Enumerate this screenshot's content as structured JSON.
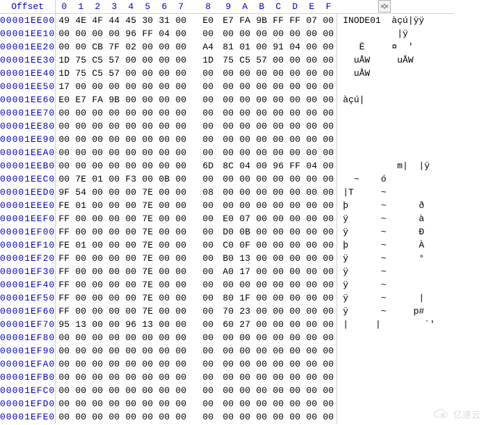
{
  "header": {
    "offset_label": "Offset",
    "columns": [
      "0",
      "1",
      "2",
      "3",
      "4",
      "5",
      "6",
      "7",
      "8",
      "9",
      "A",
      "B",
      "C",
      "D",
      "E",
      "F"
    ],
    "ascii_label": ""
  },
  "rows": [
    {
      "offset": "00001EE00",
      "hex": [
        "49",
        "4E",
        "4F",
        "44",
        "45",
        "30",
        "31",
        "00",
        "E0",
        "E7",
        "FA",
        "9B",
        "FF",
        "FF",
        "07",
        "00"
      ],
      "ascii": "INODE01  àçú|ÿÿ"
    },
    {
      "offset": "00001EE10",
      "hex": [
        "00",
        "00",
        "00",
        "00",
        "96",
        "FF",
        "04",
        "00",
        "00",
        "00",
        "00",
        "00",
        "00",
        "00",
        "00",
        "00"
      ],
      "ascii": "          |ÿ"
    },
    {
      "offset": "00001EE20",
      "hex": [
        "00",
        "00",
        "CB",
        "7F",
        "02",
        "00",
        "00",
        "00",
        "A4",
        "81",
        "01",
        "00",
        "91",
        "04",
        "00",
        "00"
      ],
      "ascii": "   Ë     ¤  '"
    },
    {
      "offset": "00001EE30",
      "hex": [
        "1D",
        "75",
        "C5",
        "57",
        "00",
        "00",
        "00",
        "00",
        "1D",
        "75",
        "C5",
        "57",
        "00",
        "00",
        "00",
        "00"
      ],
      "ascii": "  uÅW     uÅW"
    },
    {
      "offset": "00001EE40",
      "hex": [
        "1D",
        "75",
        "C5",
        "57",
        "00",
        "00",
        "00",
        "00",
        "00",
        "00",
        "00",
        "00",
        "00",
        "00",
        "00",
        "00"
      ],
      "ascii": "  uÅW"
    },
    {
      "offset": "00001EE50",
      "hex": [
        "17",
        "00",
        "00",
        "00",
        "00",
        "00",
        "00",
        "00",
        "00",
        "00",
        "00",
        "00",
        "00",
        "00",
        "00",
        "00"
      ],
      "ascii": ""
    },
    {
      "offset": "00001EE60",
      "hex": [
        "E0",
        "E7",
        "FA",
        "9B",
        "00",
        "00",
        "00",
        "00",
        "00",
        "00",
        "00",
        "00",
        "00",
        "00",
        "00",
        "00"
      ],
      "ascii": "àçú|"
    },
    {
      "offset": "00001EE70",
      "hex": [
        "00",
        "00",
        "00",
        "00",
        "00",
        "00",
        "00",
        "00",
        "00",
        "00",
        "00",
        "00",
        "00",
        "00",
        "00",
        "00"
      ],
      "ascii": ""
    },
    {
      "offset": "00001EE80",
      "hex": [
        "00",
        "00",
        "00",
        "00",
        "00",
        "00",
        "00",
        "00",
        "00",
        "00",
        "00",
        "00",
        "00",
        "00",
        "00",
        "00"
      ],
      "ascii": ""
    },
    {
      "offset": "00001EE90",
      "hex": [
        "00",
        "00",
        "00",
        "00",
        "00",
        "00",
        "00",
        "00",
        "00",
        "00",
        "00",
        "00",
        "00",
        "00",
        "00",
        "00"
      ],
      "ascii": ""
    },
    {
      "offset": "00001EEA0",
      "hex": [
        "00",
        "00",
        "00",
        "00",
        "00",
        "00",
        "00",
        "00",
        "00",
        "00",
        "00",
        "00",
        "00",
        "00",
        "00",
        "00"
      ],
      "ascii": ""
    },
    {
      "offset": "00001EEB0",
      "hex": [
        "00",
        "00",
        "00",
        "00",
        "00",
        "00",
        "00",
        "00",
        "6D",
        "8C",
        "04",
        "00",
        "96",
        "FF",
        "04",
        "00"
      ],
      "ascii": "          m|  |ÿ"
    },
    {
      "offset": "00001EEC0",
      "hex": [
        "00",
        "7E",
        "01",
        "00",
        "F3",
        "00",
        "0B",
        "00",
        "00",
        "00",
        "00",
        "00",
        "00",
        "00",
        "00",
        "00"
      ],
      "ascii": "  ~    ó"
    },
    {
      "offset": "00001EED0",
      "hex": [
        "9F",
        "54",
        "00",
        "00",
        "00",
        "7E",
        "00",
        "00",
        "08",
        "00",
        "00",
        "00",
        "00",
        "00",
        "00",
        "00"
      ],
      "ascii": "|T     ~"
    },
    {
      "offset": "00001EEE0",
      "hex": [
        "FE",
        "01",
        "00",
        "00",
        "00",
        "7E",
        "00",
        "00",
        "00",
        "00",
        "00",
        "00",
        "00",
        "00",
        "00",
        "00"
      ],
      "ascii": "þ      ~      ð"
    },
    {
      "offset": "00001EEF0",
      "hex": [
        "FF",
        "00",
        "00",
        "00",
        "00",
        "7E",
        "00",
        "00",
        "00",
        "E0",
        "07",
        "00",
        "00",
        "00",
        "00",
        "00"
      ],
      "ascii": "ÿ      ~      à"
    },
    {
      "offset": "00001EF00",
      "hex": [
        "FF",
        "00",
        "00",
        "00",
        "00",
        "7E",
        "00",
        "00",
        "00",
        "D0",
        "0B",
        "00",
        "00",
        "00",
        "00",
        "00"
      ],
      "ascii": "ÿ      ~      Ð"
    },
    {
      "offset": "00001EF10",
      "hex": [
        "FE",
        "01",
        "00",
        "00",
        "00",
        "7E",
        "00",
        "00",
        "00",
        "C0",
        "0F",
        "00",
        "00",
        "00",
        "00",
        "00"
      ],
      "ascii": "þ      ~      À"
    },
    {
      "offset": "00001EF20",
      "hex": [
        "FF",
        "00",
        "00",
        "00",
        "00",
        "7E",
        "00",
        "00",
        "00",
        "B0",
        "13",
        "00",
        "00",
        "00",
        "00",
        "00"
      ],
      "ascii": "ÿ      ~      °"
    },
    {
      "offset": "00001EF30",
      "hex": [
        "FF",
        "00",
        "00",
        "00",
        "00",
        "7E",
        "00",
        "00",
        "00",
        "A0",
        "17",
        "00",
        "00",
        "00",
        "00",
        "00"
      ],
      "ascii": "ÿ      ~"
    },
    {
      "offset": "00001EF40",
      "hex": [
        "FF",
        "00",
        "00",
        "00",
        "00",
        "7E",
        "00",
        "00",
        "00",
        "00",
        "00",
        "00",
        "00",
        "00",
        "00",
        "00"
      ],
      "ascii": "ÿ      ~"
    },
    {
      "offset": "00001EF50",
      "hex": [
        "FF",
        "00",
        "00",
        "00",
        "00",
        "7E",
        "00",
        "00",
        "00",
        "80",
        "1F",
        "00",
        "00",
        "00",
        "00",
        "00"
      ],
      "ascii": "ÿ      ~      |"
    },
    {
      "offset": "00001EF60",
      "hex": [
        "FF",
        "00",
        "00",
        "00",
        "00",
        "7E",
        "00",
        "00",
        "00",
        "70",
        "23",
        "00",
        "00",
        "00",
        "00",
        "00"
      ],
      "ascii": "ÿ      ~     p#"
    },
    {
      "offset": "00001EF70",
      "hex": [
        "95",
        "13",
        "00",
        "00",
        "96",
        "13",
        "00",
        "00",
        "00",
        "60",
        "27",
        "00",
        "00",
        "00",
        "00",
        "00"
      ],
      "ascii": "|     |        `'"
    },
    {
      "offset": "00001EF80",
      "hex": [
        "00",
        "00",
        "00",
        "00",
        "00",
        "00",
        "00",
        "00",
        "00",
        "00",
        "00",
        "00",
        "00",
        "00",
        "00",
        "00"
      ],
      "ascii": ""
    },
    {
      "offset": "00001EF90",
      "hex": [
        "00",
        "00",
        "00",
        "00",
        "00",
        "00",
        "00",
        "00",
        "00",
        "00",
        "00",
        "00",
        "00",
        "00",
        "00",
        "00"
      ],
      "ascii": ""
    },
    {
      "offset": "00001EFA0",
      "hex": [
        "00",
        "00",
        "00",
        "00",
        "00",
        "00",
        "00",
        "00",
        "00",
        "00",
        "00",
        "00",
        "00",
        "00",
        "00",
        "00"
      ],
      "ascii": ""
    },
    {
      "offset": "00001EFB0",
      "hex": [
        "00",
        "00",
        "00",
        "00",
        "00",
        "00",
        "00",
        "00",
        "00",
        "00",
        "00",
        "00",
        "00",
        "00",
        "00",
        "00"
      ],
      "ascii": ""
    },
    {
      "offset": "00001EFC0",
      "hex": [
        "00",
        "00",
        "00",
        "00",
        "00",
        "00",
        "00",
        "00",
        "00",
        "00",
        "00",
        "00",
        "00",
        "00",
        "00",
        "00"
      ],
      "ascii": ""
    },
    {
      "offset": "00001EFD0",
      "hex": [
        "00",
        "00",
        "00",
        "00",
        "00",
        "00",
        "00",
        "00",
        "00",
        "00",
        "00",
        "00",
        "00",
        "00",
        "00",
        "00"
      ],
      "ascii": ""
    },
    {
      "offset": "00001EFE0",
      "hex": [
        "00",
        "00",
        "00",
        "00",
        "00",
        "00",
        "00",
        "00",
        "00",
        "00",
        "00",
        "00",
        "00",
        "00",
        "00",
        "00"
      ],
      "ascii": ""
    }
  ],
  "watermark": {
    "text": "亿速云"
  }
}
